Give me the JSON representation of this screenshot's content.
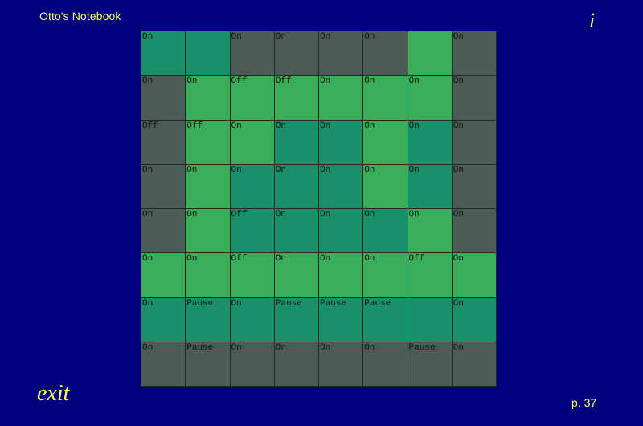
{
  "header": {
    "title": "Otto's Notebook",
    "info_label": "i"
  },
  "footer": {
    "exit_label": "exit",
    "page_label": "p. 37"
  },
  "colors": {
    "G": "#4b5c56",
    "L": "#39ad58",
    "T": "#18906a",
    "background": "#00007f",
    "text": "#ffff66"
  },
  "grid": {
    "rows": [
      [
        {
          "c": "T",
          "t": "On"
        },
        {
          "c": "T",
          "t": ""
        },
        {
          "c": "G",
          "t": "On"
        },
        {
          "c": "G",
          "t": "On"
        },
        {
          "c": "G",
          "t": "On"
        },
        {
          "c": "G",
          "t": "On"
        },
        {
          "c": "L",
          "t": ""
        },
        {
          "c": "G",
          "t": "On"
        }
      ],
      [
        {
          "c": "G",
          "t": "On"
        },
        {
          "c": "L",
          "t": "On"
        },
        {
          "c": "L",
          "t": "Off"
        },
        {
          "c": "L",
          "t": "Off"
        },
        {
          "c": "L",
          "t": "On"
        },
        {
          "c": "L",
          "t": "On"
        },
        {
          "c": "L",
          "t": "On"
        },
        {
          "c": "G",
          "t": "On"
        }
      ],
      [
        {
          "c": "G",
          "t": "Off"
        },
        {
          "c": "L",
          "t": "Off"
        },
        {
          "c": "L",
          "t": "On"
        },
        {
          "c": "T",
          "t": "On"
        },
        {
          "c": "T",
          "t": "On"
        },
        {
          "c": "L",
          "t": "On"
        },
        {
          "c": "T",
          "t": "On"
        },
        {
          "c": "G",
          "t": "On"
        }
      ],
      [
        {
          "c": "G",
          "t": "On"
        },
        {
          "c": "L",
          "t": "On"
        },
        {
          "c": "T",
          "t": "On"
        },
        {
          "c": "T",
          "t": "On"
        },
        {
          "c": "T",
          "t": "On"
        },
        {
          "c": "L",
          "t": "On"
        },
        {
          "c": "T",
          "t": "On"
        },
        {
          "c": "G",
          "t": "On"
        }
      ],
      [
        {
          "c": "G",
          "t": "On"
        },
        {
          "c": "L",
          "t": "On"
        },
        {
          "c": "T",
          "t": "Off"
        },
        {
          "c": "T",
          "t": "On"
        },
        {
          "c": "T",
          "t": "On"
        },
        {
          "c": "T",
          "t": "On"
        },
        {
          "c": "L",
          "t": "On"
        },
        {
          "c": "G",
          "t": "On"
        }
      ],
      [
        {
          "c": "L",
          "t": "On"
        },
        {
          "c": "L",
          "t": "On"
        },
        {
          "c": "L",
          "t": "Off"
        },
        {
          "c": "L",
          "t": "On"
        },
        {
          "c": "L",
          "t": "On"
        },
        {
          "c": "L",
          "t": "On"
        },
        {
          "c": "L",
          "t": "Off"
        },
        {
          "c": "L",
          "t": "On"
        }
      ],
      [
        {
          "c": "T",
          "t": "On"
        },
        {
          "c": "T",
          "t": "Pause"
        },
        {
          "c": "T",
          "t": "On"
        },
        {
          "c": "T",
          "t": "Pause"
        },
        {
          "c": "T",
          "t": "Pause"
        },
        {
          "c": "T",
          "t": "Pause"
        },
        {
          "c": "T",
          "t": ""
        },
        {
          "c": "T",
          "t": "On"
        }
      ],
      [
        {
          "c": "G",
          "t": "On"
        },
        {
          "c": "G",
          "t": "Pause"
        },
        {
          "c": "G",
          "t": "On"
        },
        {
          "c": "G",
          "t": "On"
        },
        {
          "c": "G",
          "t": "On"
        },
        {
          "c": "G",
          "t": "On"
        },
        {
          "c": "G",
          "t": "Pause"
        },
        {
          "c": "G",
          "t": "On"
        }
      ]
    ]
  }
}
